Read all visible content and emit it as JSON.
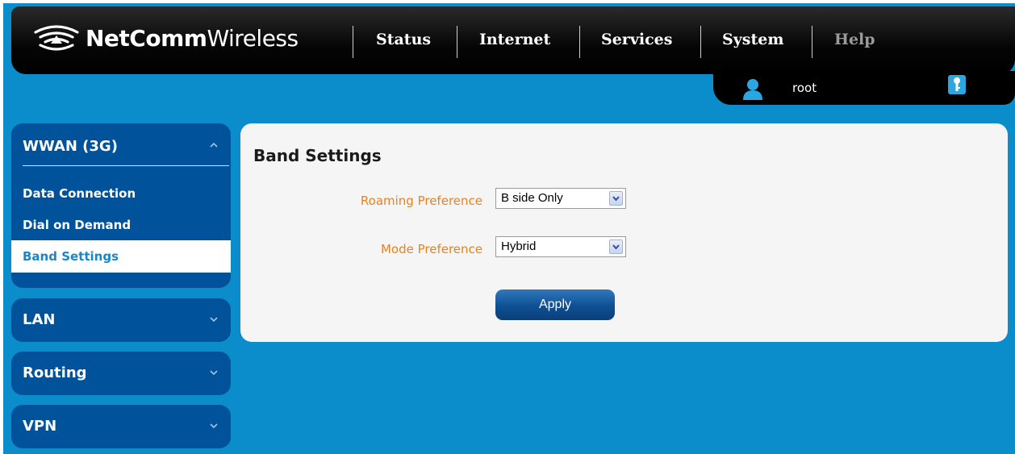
{
  "header": {
    "brand_bold": "NetComm",
    "brand_light": "Wireless",
    "nav": [
      "Status",
      "Internet",
      "Services",
      "System",
      "Help"
    ]
  },
  "user": {
    "name": "root"
  },
  "sidebar": {
    "sections": [
      {
        "title": "WWAN (3G)",
        "expanded": true,
        "items": [
          "Data Connection",
          "Dial on Demand",
          "Band Settings"
        ],
        "active": "Band Settings"
      },
      {
        "title": "LAN",
        "expanded": false
      },
      {
        "title": "Routing",
        "expanded": false
      },
      {
        "title": "VPN",
        "expanded": false
      }
    ]
  },
  "main": {
    "title": "Band Settings",
    "fields": [
      {
        "label": "Roaming Preference",
        "value": "B side Only"
      },
      {
        "label": "Mode Preference",
        "value": "Hybrid"
      }
    ],
    "apply_label": "Apply"
  },
  "colors": {
    "background": "#0a8dca",
    "sidebar": "#00529b",
    "label": "#e8821e",
    "active_text": "#1a86c8"
  },
  "icons": [
    "wifi-logo-icon",
    "user-icon",
    "key-icon",
    "chevron-up-icon",
    "chevron-down-icon",
    "dropdown-arrow-icon"
  ]
}
